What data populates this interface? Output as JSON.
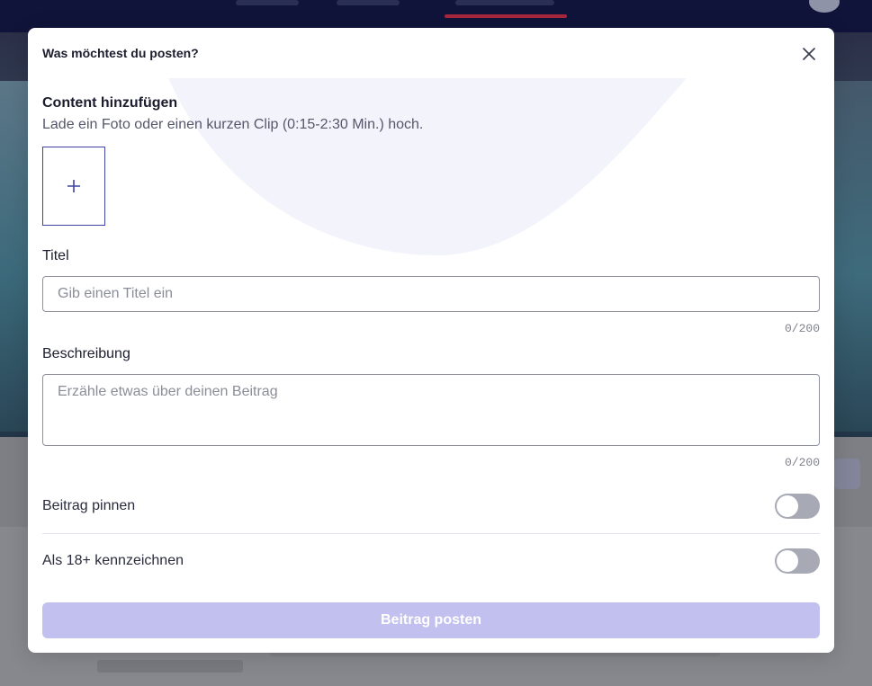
{
  "modal": {
    "title": "Was möchtest du posten?",
    "close_icon": "close-icon"
  },
  "content": {
    "heading": "Content hinzufügen",
    "subtitle": "Lade ein Foto oder einen kurzen Clip (0:15-2:30 Min.) hoch.",
    "upload_icon": "plus-icon"
  },
  "title_field": {
    "label": "Titel",
    "placeholder": "Gib einen Titel ein",
    "value": "",
    "counter": "0/200"
  },
  "description_field": {
    "label": "Beschreibung",
    "placeholder": "Erzähle etwas über deinen Beitrag",
    "value": "",
    "counter": "0/200"
  },
  "toggles": [
    {
      "label": "Beitrag pinnen",
      "on": false
    },
    {
      "label": "Als 18+ kennzeichnen",
      "on": false
    }
  ],
  "submit": {
    "label": "Beitrag posten",
    "disabled": true
  },
  "colors": {
    "accent": "#3f43a3",
    "submit_disabled": "#c1c0ee",
    "toggle_off": "#a7a9b4",
    "overlay": "#7f8187"
  }
}
